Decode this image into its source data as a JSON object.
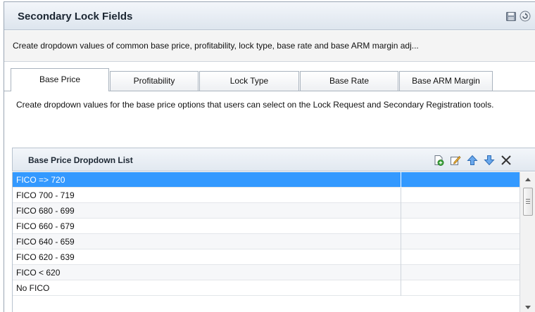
{
  "window": {
    "title": "Secondary Lock Fields",
    "description": "Create dropdown values of common base price, profitability, lock type, base rate and base ARM margin adj..."
  },
  "tabs": [
    {
      "label": "Base Price",
      "active": true
    },
    {
      "label": "Profitability",
      "active": false
    },
    {
      "label": "Lock Type",
      "active": false
    },
    {
      "label": "Base Rate",
      "active": false
    },
    {
      "label": "Base ARM Margin",
      "active": false
    }
  ],
  "help_text": "Create dropdown values for the base price options that users can select on the Lock Request and Secondary Registration tools.",
  "grid": {
    "title": "Base Price Dropdown List",
    "toolbar_icons": [
      "add-icon",
      "edit-icon",
      "move-up-icon",
      "move-down-icon",
      "delete-icon"
    ],
    "rows": [
      {
        "value": "FICO => 720",
        "selected": true
      },
      {
        "value": "FICO 700 - 719",
        "selected": false
      },
      {
        "value": "FICO 680 - 699",
        "selected": false
      },
      {
        "value": "FICO 660 - 679",
        "selected": false
      },
      {
        "value": "FICO 640 - 659",
        "selected": false
      },
      {
        "value": "FICO 620 - 639",
        "selected": false
      },
      {
        "value": "FICO < 620",
        "selected": false
      },
      {
        "value": "No FICO",
        "selected": false
      }
    ]
  },
  "colors": {
    "selection": "#3399ff",
    "header_gradient_top": "#f3f6fa",
    "header_gradient_bottom": "#dde5ee",
    "move_arrow": "#4a8fdc"
  },
  "title_icons": [
    "save-icon",
    "refresh-icon"
  ]
}
